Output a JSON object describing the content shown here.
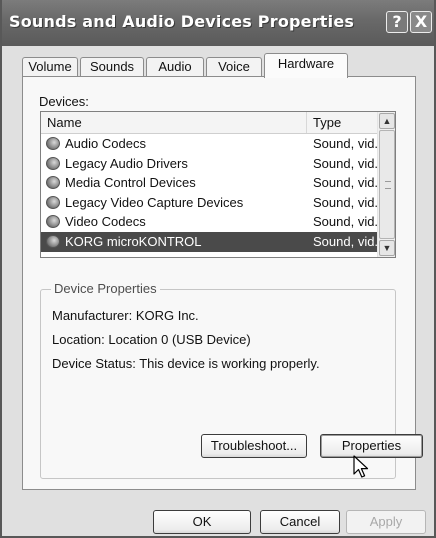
{
  "window": {
    "title": "Sounds and Audio Devices Properties"
  },
  "titlebar_buttons": {
    "help": "?",
    "close": "X"
  },
  "tabs": [
    {
      "label": "Volume",
      "active": false
    },
    {
      "label": "Sounds",
      "active": false
    },
    {
      "label": "Audio",
      "active": false
    },
    {
      "label": "Voice",
      "active": false
    },
    {
      "label": "Hardware",
      "active": true
    }
  ],
  "hardware": {
    "devices_label": "Devices:",
    "columns": {
      "name": "Name",
      "type": "Type"
    },
    "devices": [
      {
        "name": "Audio Codecs",
        "type": "Sound, vid...",
        "selected": false
      },
      {
        "name": "Legacy Audio Drivers",
        "type": "Sound, vid...",
        "selected": false
      },
      {
        "name": "Media Control Devices",
        "type": "Sound, vid...",
        "selected": false
      },
      {
        "name": "Legacy Video Capture Devices",
        "type": "Sound, vid...",
        "selected": false
      },
      {
        "name": "Video Codecs",
        "type": "Sound, vid...",
        "selected": false
      },
      {
        "name": "KORG microKONTROL",
        "type": "Sound, vid...",
        "selected": true
      }
    ],
    "device_properties": {
      "group_title": "Device Properties",
      "manufacturer": "Manufacturer: KORG Inc.",
      "location": "Location: Location 0 (USB Device)",
      "status": "Device Status: This device is working properly."
    },
    "troubleshoot_label": "Troubleshoot...",
    "properties_label": "Properties"
  },
  "dialog_buttons": {
    "ok": "OK",
    "cancel": "Cancel",
    "apply": "Apply"
  },
  "icons": {
    "device": "speaker-device-icon",
    "scroll_up": "scroll-up-arrow-icon",
    "scroll_down": "scroll-down-arrow-icon",
    "cursor": "mouse-pointer-icon"
  }
}
